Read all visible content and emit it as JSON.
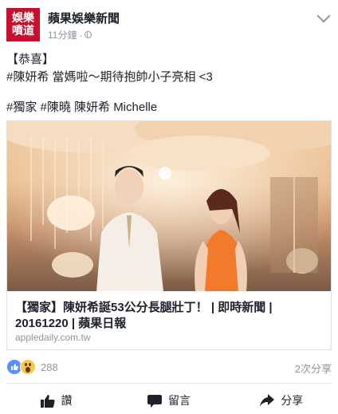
{
  "post": {
    "page_name": "蘋果娛樂新聞",
    "avatar_text": [
      "娛樂",
      "噴道"
    ],
    "time": "11分鐘",
    "dot": "·",
    "lines": [
      "【恭喜】",
      "#陳妍希 當媽啦～期待抱帥小子亮相 <3",
      "#獨家 #陳曉 陳妍希 Michelle"
    ]
  },
  "link_card": {
    "title": "【獨家】陳妍希誕53公分長腿壯丁！ | 即時新聞 | 20161220 | 蘋果日報",
    "domain": "appledaily.com.tw"
  },
  "reactions": {
    "count": "288",
    "shares": "2次分享",
    "icons": [
      "like-icon",
      "wow-icon"
    ]
  },
  "actions": {
    "like": "讚",
    "comment": "留言",
    "share": "分享"
  },
  "colors": {
    "brand_red": "#c8102e",
    "like_blue": "#5890ff",
    "meta_gray": "#90949c"
  }
}
